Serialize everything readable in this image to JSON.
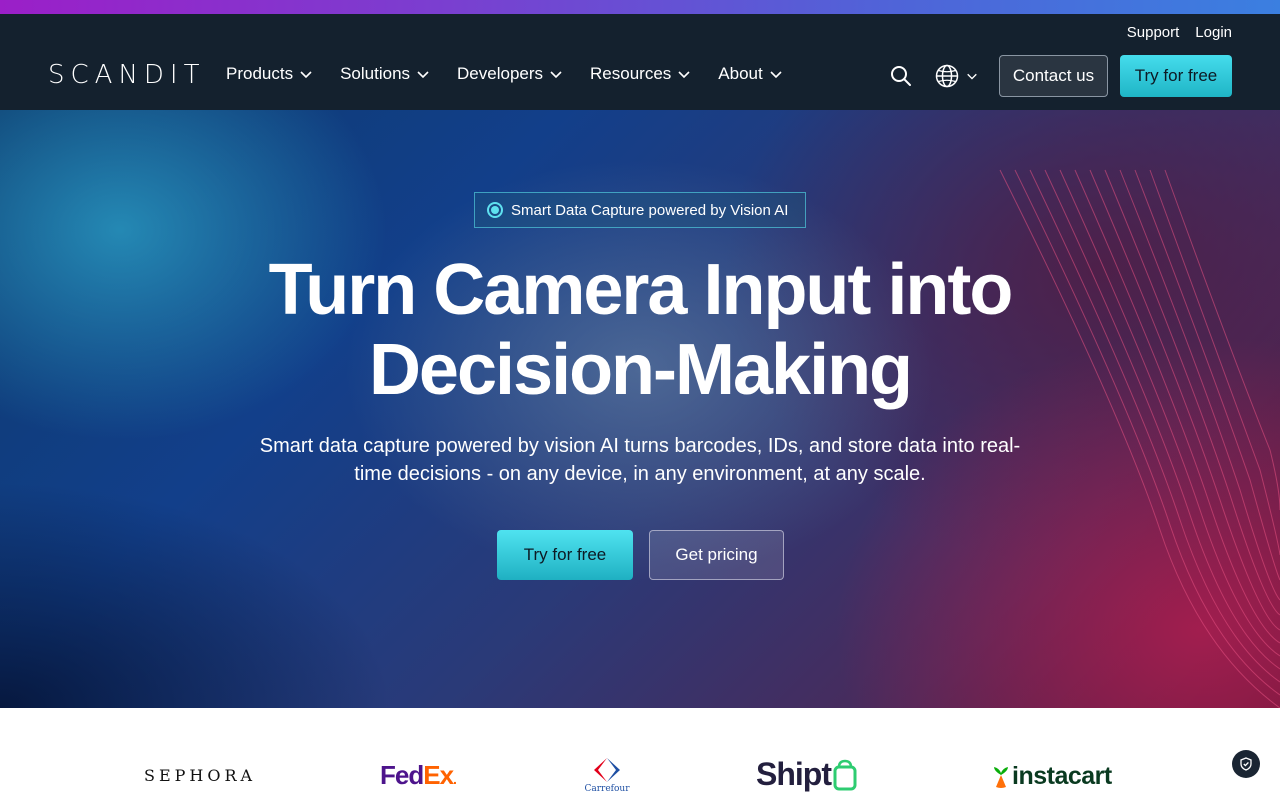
{
  "header": {
    "logo_text": "SCANDIT",
    "utility": {
      "support": "Support",
      "login": "Login"
    },
    "nav": [
      {
        "label": "Products"
      },
      {
        "label": "Solutions"
      },
      {
        "label": "Developers"
      },
      {
        "label": "Resources"
      },
      {
        "label": "About"
      }
    ],
    "contact_label": "Contact us",
    "try_label": "Try for free"
  },
  "hero": {
    "badge": "Smart Data Capture powered by Vision AI",
    "title_line1": "Turn Camera Input into",
    "title_line2": "Decision-Making",
    "subtitle_line1": "Smart data capture powered by vision AI turns barcodes, IDs, and store data into real-",
    "subtitle_line2": "time decisions - on any device, in any environment, at any scale.",
    "try_label": "Try for free",
    "pricing_label": "Get pricing"
  },
  "customers": {
    "sephora": "SEPHORA",
    "fedex_fed": "Fed",
    "fedex_ex": "Ex",
    "carrefour": "Carrefour",
    "shipt": "Shipt",
    "instacart": "instacart"
  },
  "colors": {
    "header_bg": "#14212e",
    "accent_cyan": "#45dcec",
    "fedex_purple": "#4d148c",
    "fedex_orange": "#ff6200"
  },
  "icons": [
    "chevron-down-icon",
    "search-icon",
    "globe-icon",
    "shield-icon",
    "carrot-icon",
    "shopping-bag-icon"
  ]
}
